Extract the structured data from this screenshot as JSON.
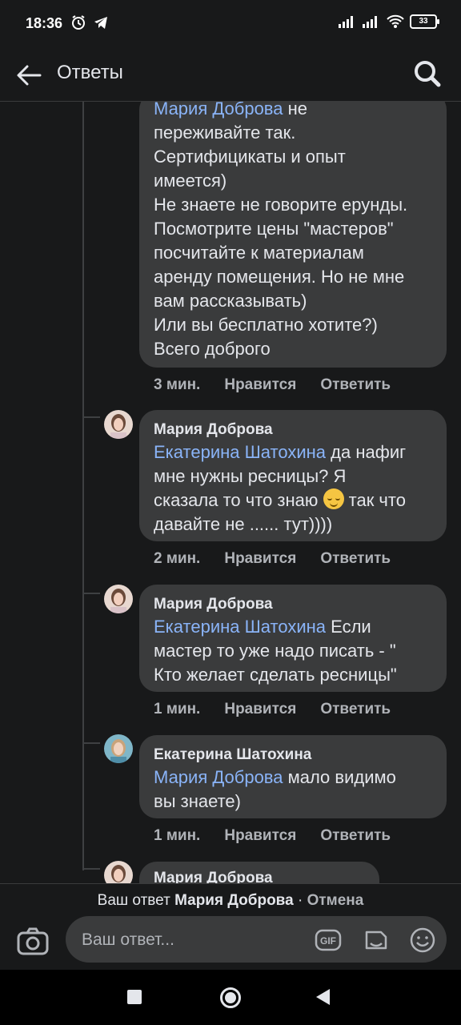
{
  "status_bar": {
    "time": "18:36",
    "battery": "33"
  },
  "app_bar": {
    "title": "Ответы"
  },
  "comments": [
    {
      "mention": "Мария Доброва",
      "text": " не\nпереживайте так.\nСертифицикаты и опыт\nимеется)\nНе знаете не говорите ерунды.\nПосмотрите цены \"мастеров\"\nпосчитайте к материалам\nаренду помещения. Но не мне\nвам рассказывать)\nИли вы бесплатно хотите?)\nВсего доброго",
      "time": "3 мин.",
      "like": "Нравится",
      "reply": "Ответить"
    },
    {
      "author": "Мария Доброва",
      "mention": "Екатерина Шатохина",
      "text_before_emoji": " да нафиг\nмне нужны ресницы? Я\nсказала то что знаю ",
      "text_after_emoji": " так что\nдавайте не ...... тут))))",
      "emoji": "relieved-face",
      "time": "2 мин.",
      "like": "Нравится",
      "reply": "Ответить"
    },
    {
      "author": "Мария Доброва",
      "mention": "Екатерина Шатохина",
      "text": " Если\nмастер то уже надо писать - \"\nКто желает сделать ресницы\"",
      "time": "1 мин.",
      "like": "Нравится",
      "reply": "Ответить"
    },
    {
      "author": "Екатерина Шатохина",
      "mention": "Мария Доброва",
      "text": " мало видимо\nвы знаете)",
      "time": "1 мин.",
      "like": "Нравится",
      "reply": "Ответить"
    },
    {
      "author": "Мария Доброва"
    }
  ],
  "reply_bar": {
    "prefix": "Ваш ответ ",
    "target": "Мария Доброва",
    "separator": " · ",
    "cancel": "Отмена",
    "placeholder": "Ваш ответ..."
  },
  "colors": {
    "mention": "#8ab4f8",
    "bubble": "#3a3b3c",
    "background": "#18191a"
  }
}
